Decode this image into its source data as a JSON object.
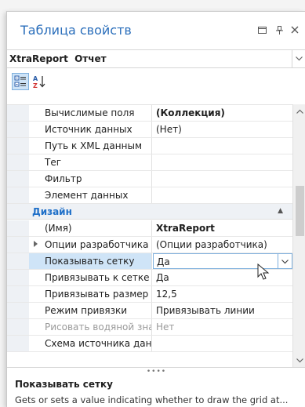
{
  "window": {
    "title": "Таблица свойств",
    "controls": {
      "menu": "▭",
      "pin": "⊥",
      "close": "✕"
    }
  },
  "object_selector": {
    "name": "XtraReport",
    "type": "Отчет",
    "arrow": "⌄"
  },
  "toolbar": {
    "categorized_icon": "categorized-view-icon",
    "alphabetical_icon": "sort-az-icon"
  },
  "grid": {
    "rows_top": [
      {
        "name": "Вычислимые поля",
        "value": "(Коллекция)",
        "bold": true
      },
      {
        "name": "Источник данных",
        "value": "(Нет)"
      },
      {
        "name": "Путь к XML данным",
        "value": ""
      },
      {
        "name": "Тег",
        "value": ""
      },
      {
        "name": "Фильтр",
        "value": ""
      },
      {
        "name": "Элемент данных",
        "value": ""
      }
    ],
    "category": {
      "label": "Дизайн",
      "toggle": "▲"
    },
    "rows_design": [
      {
        "name": "(Имя)",
        "value": "XtraReport",
        "bold": true
      },
      {
        "name": "Опции разработчика",
        "value": "(Опции разработчика)",
        "expandable": true
      },
      {
        "name": "Показывать сетку",
        "value": "Да",
        "selected": true
      },
      {
        "name": "Привязывать к сетке",
        "value": "Да"
      },
      {
        "name": "Привязывать размер сетки",
        "value": "12,5"
      },
      {
        "name": "Режим привязки",
        "value": "Привязывать линии"
      },
      {
        "name": "Рисовать водяной знак",
        "value": "Нет",
        "disabled": true
      },
      {
        "name": "Схема источника данных",
        "value": ""
      }
    ]
  },
  "splitter": "••••",
  "description": {
    "title": "Показывать сетку",
    "text": "Gets or sets a value indicating whether to draw the grid at..."
  }
}
